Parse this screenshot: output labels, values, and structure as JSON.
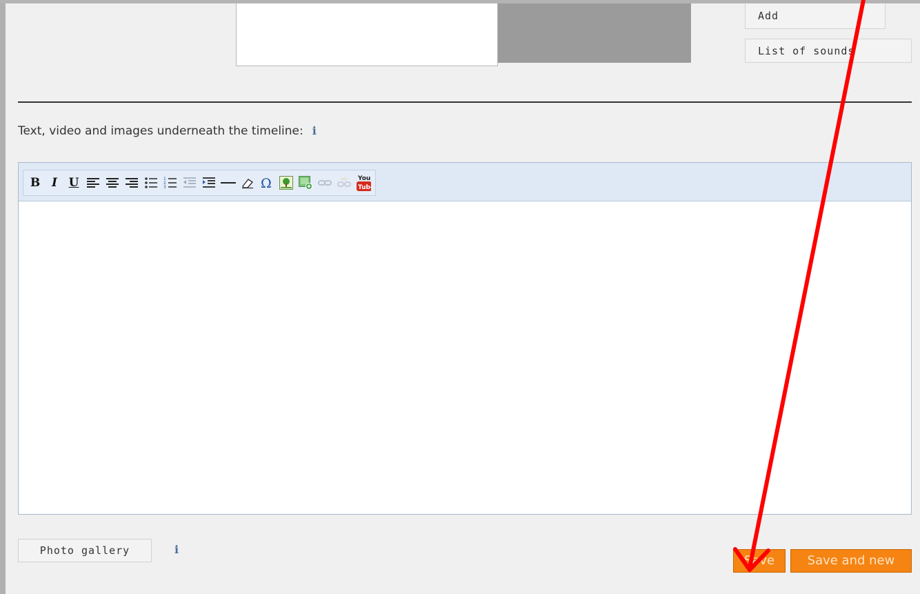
{
  "sound_panel": {
    "add_label": "Add",
    "list_sounds_label": "List of sounds"
  },
  "text_section": {
    "label": "Text, video and images underneath the timeline:",
    "info_glyph": "i"
  },
  "editor_toolbar": {
    "bold": "B",
    "italic": "I",
    "underline": "U",
    "youtube_top": "You",
    "youtube_bottom": "Tube",
    "icons": [
      "bold-icon",
      "italic-icon",
      "underline-icon",
      "align-left-icon",
      "align-center-icon",
      "align-right-icon",
      "bullet-list-icon",
      "numbered-list-icon",
      "outdent-icon",
      "indent-icon",
      "horizontal-rule-icon",
      "eraser-icon",
      "special-char-icon",
      "insert-image-icon",
      "image-add-icon",
      "link-icon",
      "unlink-icon",
      "youtube-icon"
    ]
  },
  "footer": {
    "photo_gallery_label": "Photo gallery",
    "info_glyph": "i",
    "save_label": "Save",
    "save_new_label": "Save and new"
  },
  "colors": {
    "accent_orange": "#f58412",
    "annotation_arrow": "#ff0000",
    "toolbar_bg": "#dfe9f6"
  }
}
